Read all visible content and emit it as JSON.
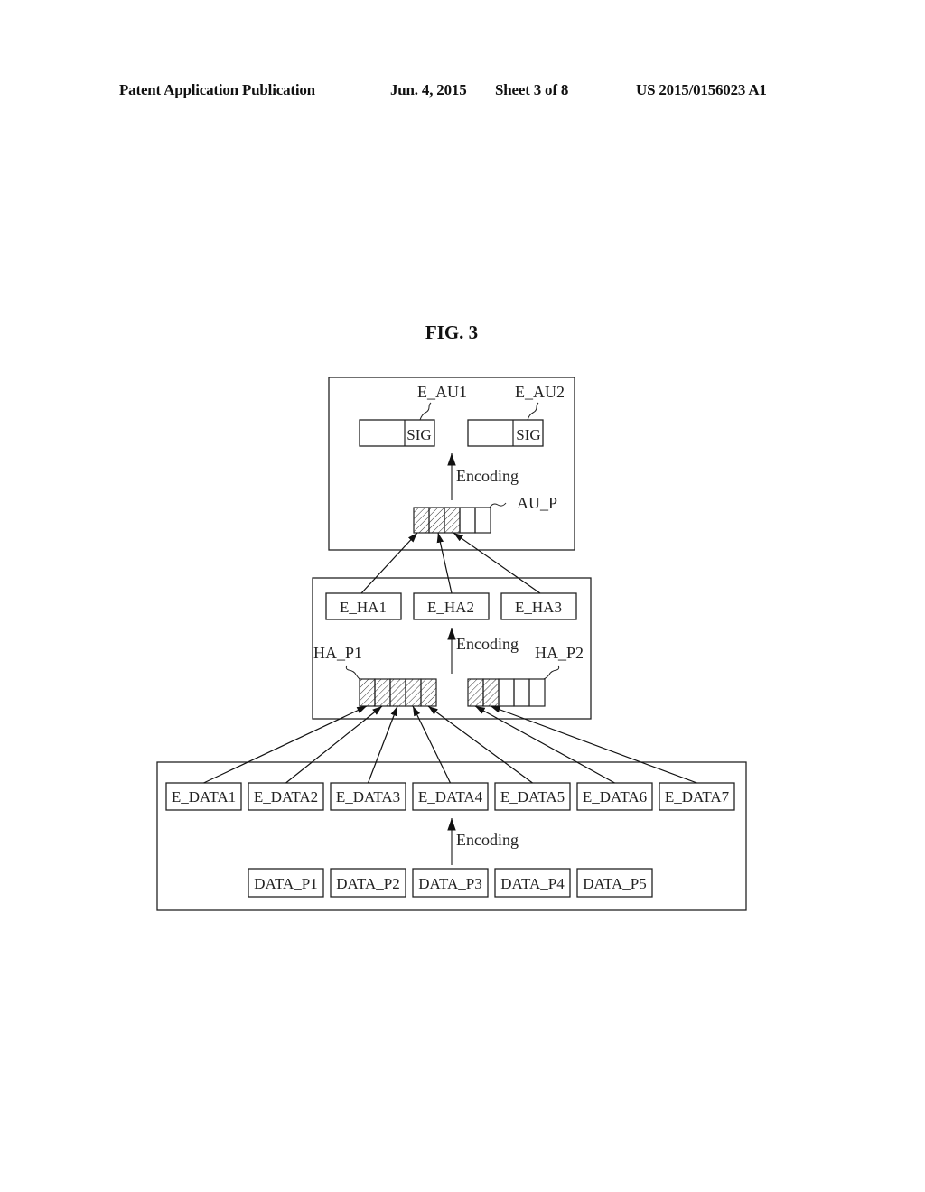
{
  "header": {
    "publication_type": "Patent Application Publication",
    "date": "Jun. 4, 2015",
    "sheet": "Sheet 3 of 8",
    "patent_number": "US 2015/0156023 A1"
  },
  "figure": {
    "title": "FIG. 3",
    "top_block": {
      "labels": {
        "e_au1": "E_AU1",
        "e_au2": "E_AU2",
        "au_p": "AU_P"
      },
      "sig_label": "SIG",
      "encoding_label": "Encoding",
      "au_p_cells": {
        "total": 5,
        "hatched": 3
      }
    },
    "middle_block": {
      "e_ha": [
        "E_HA1",
        "E_HA2",
        "E_HA3"
      ],
      "labels": {
        "ha_p1": "HA_P1",
        "ha_p2": "HA_P2"
      },
      "encoding_label": "Encoding",
      "ha_p1_cells": {
        "total": 5,
        "hatched": 5
      },
      "ha_p2_cells": {
        "total": 5,
        "hatched": 2
      }
    },
    "bottom_block": {
      "e_data": [
        "E_DATA1",
        "E_DATA2",
        "E_DATA3",
        "E_DATA4",
        "E_DATA5",
        "E_DATA6",
        "E_DATA7"
      ],
      "data_p": [
        "DATA_P1",
        "DATA_P2",
        "DATA_P3",
        "DATA_P4",
        "DATA_P5"
      ],
      "encoding_label": "Encoding"
    }
  }
}
